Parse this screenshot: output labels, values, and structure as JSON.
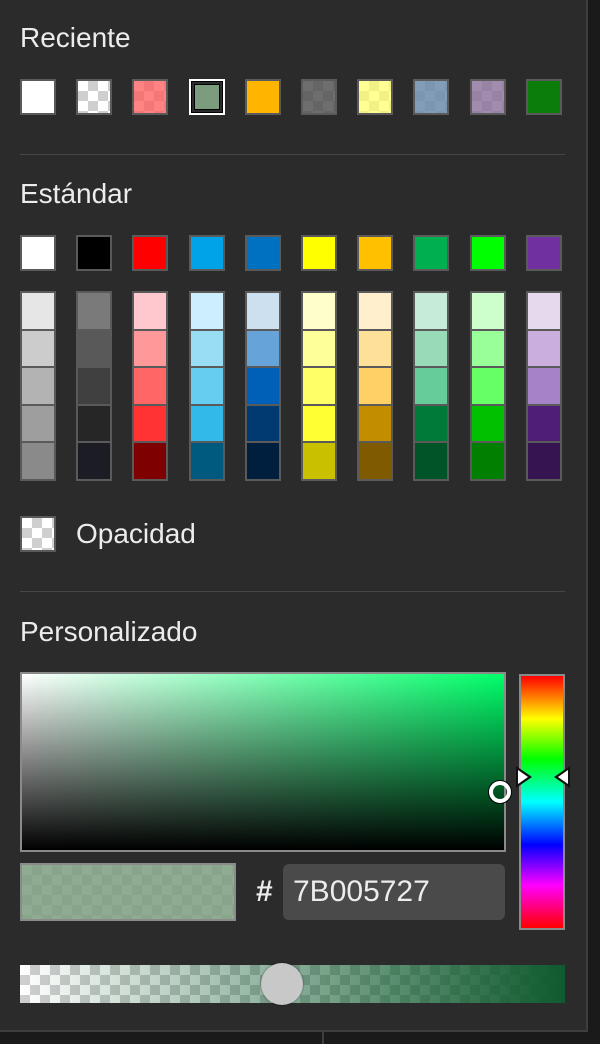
{
  "recent": {
    "heading": "Reciente",
    "swatches": [
      {
        "color": "#ffffff",
        "alpha": 1.0
      },
      {
        "color": "#ffffff",
        "alpha": 0.0
      },
      {
        "color": "#ff5a5a",
        "alpha": 0.75
      },
      {
        "color": "#7b9c7f",
        "alpha": 1.0,
        "selected": true
      },
      {
        "color": "#ffb400",
        "alpha": 1.0
      },
      {
        "color": "#4a4a4a",
        "alpha": 0.8
      },
      {
        "color": "#ffff66",
        "alpha": 0.7
      },
      {
        "color": "#6c8cab",
        "alpha": 0.85
      },
      {
        "color": "#8a6f9a",
        "alpha": 0.8
      },
      {
        "color": "#0a7d0a",
        "alpha": 1.0
      }
    ]
  },
  "standard": {
    "heading": "Estándar",
    "base": [
      "#ffffff",
      "#000000",
      "#ff0000",
      "#00a2e8",
      "#0070c0",
      "#ffff00",
      "#ffc000",
      "#00b050",
      "#00ff00",
      "#7030a0"
    ],
    "shades": [
      [
        "#e6e6e6",
        "#cccccc",
        "#b3b3b3",
        "#9e9e9e",
        "#8a8a8a"
      ],
      [
        "#7a7a7a",
        "#595959",
        "#404040",
        "#262626",
        "#1c1c24"
      ],
      [
        "#ffc7ce",
        "#ff9999",
        "#ff6666",
        "#ff3333",
        "#7f0000"
      ],
      [
        "#cceeff",
        "#99ddf5",
        "#66ccf0",
        "#33b8ea",
        "#005a7f"
      ],
      [
        "#cce0f0",
        "#66a3d9",
        "#0060b8",
        "#003a70",
        "#001f3f"
      ],
      [
        "#ffffcc",
        "#ffff99",
        "#ffff66",
        "#ffff33",
        "#c9c100"
      ],
      [
        "#ffefcc",
        "#ffe099",
        "#ffd066",
        "#c28e00",
        "#7f5a00"
      ],
      [
        "#c6ecd9",
        "#99dbb8",
        "#66cc99",
        "#007a38",
        "#005428"
      ],
      [
        "#ccffcc",
        "#99ff99",
        "#66ff66",
        "#00c000",
        "#007f00"
      ],
      [
        "#e6d9ee",
        "#c9aede",
        "#a683c8",
        "#4f1f78",
        "#361452"
      ]
    ]
  },
  "opacity": {
    "label": "Opacidad"
  },
  "custom": {
    "heading": "Personalizado",
    "hue_color": "#00ff6a",
    "current_color": "#7b9c7f",
    "hash_label": "#",
    "hex_value": "7B005727",
    "alpha_fraction": 0.48,
    "alpha_color": "#0f5a2e"
  }
}
